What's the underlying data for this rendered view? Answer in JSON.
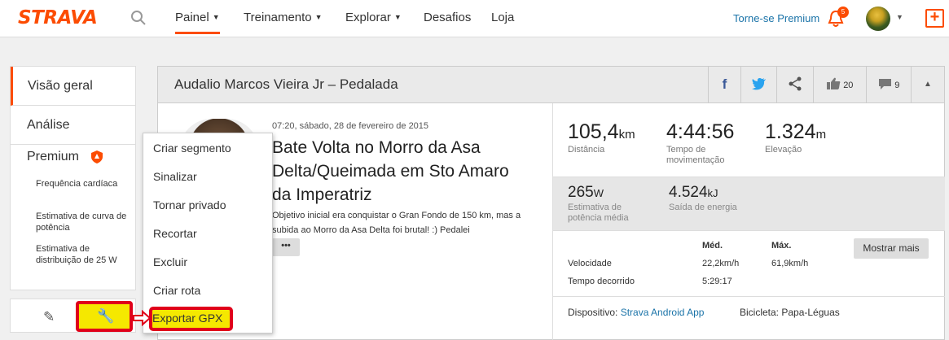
{
  "topbar": {
    "logo": "STRAVA",
    "nav": [
      {
        "label": "Painel",
        "has_caret": true
      },
      {
        "label": "Treinamento",
        "has_caret": true
      },
      {
        "label": "Explorar",
        "has_caret": true
      },
      {
        "label": "Desafios",
        "has_caret": false
      },
      {
        "label": "Loja",
        "has_caret": false
      }
    ],
    "premium_link": "Torne-se Premium",
    "notification_count": "5",
    "accent_color": "#fc4c02"
  },
  "sidebar": {
    "items": [
      {
        "label": "Visão geral"
      },
      {
        "label": "Análise"
      }
    ],
    "premium_label": "Premium",
    "sub_items": [
      {
        "label": "Frequência cardíaca"
      },
      {
        "label": "Estimativa de curva de potência"
      },
      {
        "label": "Estimativa de distribuição de 25 W"
      }
    ]
  },
  "card": {
    "title": "Audalio Marcos Vieira Jr – Pedalada",
    "kudos": "20",
    "comments": "9"
  },
  "activity": {
    "datetime": "07:20, sábado, 28 de fevereiro de 2015",
    "title": "Bate Volta no Morro da Asa Delta/Queimada em Sto Amaro da Imperatriz",
    "description": "Objetivo inicial era conquistar o Gran Fondo de 150 km, mas a subida ao Morro da Asa Delta foi brutal! :) Pedalei",
    "more": "•••"
  },
  "stats": {
    "distance": {
      "value": "105,4",
      "unit": "km",
      "label": "Distância"
    },
    "moving_time": {
      "value": "4:44:56",
      "label": "Tempo de movimentação"
    },
    "elevation": {
      "value": "1.324",
      "unit": "m",
      "label": "Elevação"
    },
    "power": {
      "value": "265",
      "unit": "W",
      "label": "Estimativa de potência média"
    },
    "energy": {
      "value": "4.524",
      "unit": "kJ",
      "label": "Saída de energia"
    }
  },
  "table": {
    "col_avg": "Méd.",
    "col_max": "Máx.",
    "rows": [
      {
        "label": "Velocidade",
        "avg": "22,2km/h",
        "max": "61,9km/h"
      },
      {
        "label": "Tempo decorrido",
        "avg": "5:29:17",
        "max": ""
      }
    ],
    "show_more": "Mostrar mais"
  },
  "device": {
    "label": "Dispositivo:",
    "value": "Strava Android App",
    "bike_label": "Bicicleta: Papa-Léguas"
  },
  "dropdown": {
    "items": [
      {
        "label": "Criar segmento"
      },
      {
        "label": "Sinalizar"
      },
      {
        "label": "Tornar privado"
      },
      {
        "label": "Recortar"
      },
      {
        "label": "Excluir"
      },
      {
        "label": "Criar rota"
      },
      {
        "label": "Exportar GPX"
      }
    ]
  }
}
